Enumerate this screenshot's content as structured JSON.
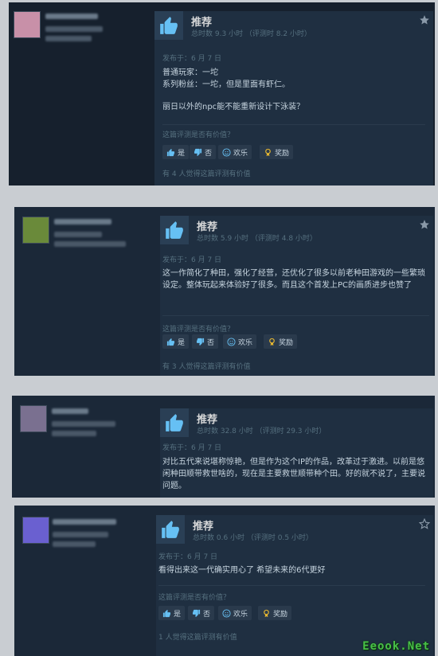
{
  "reviews": [
    {
      "recommend": "推荐",
      "hours": "总时数 9.3 小时  （评测时 8.2 小时）",
      "posted": "发布于：6 月 7 日",
      "text": [
        "普通玩家：一坨",
        "系列粉丝：一坨，但是里面有虾仁。",
        "",
        "丽日以外的npc能不能重新设计下泳装？"
      ],
      "helpful_q": "这篇评测是否有价值？",
      "yes": "是",
      "no": "否",
      "funny": "欢乐",
      "award": "奖励",
      "found": "有 4 人觉得这篇评测有价值",
      "avatar_color": "#c890a8"
    },
    {
      "recommend": "推荐",
      "hours": "总时数 5.9 小时  （评测时 4.8 小时）",
      "posted": "发布于：6 月 7 日",
      "text": [
        "这一作简化了种田，强化了经营，还优化了很多以前老种田游戏的一些繁琐设定。整体玩起来体验好了很多。而且这个首发上PC的画质进步也赞了"
      ],
      "helpful_q": "这篇评测是否有价值？",
      "yes": "是",
      "no": "否",
      "funny": "欢乐",
      "award": "奖励",
      "found": "有 3 人觉得这篇评测有价值",
      "avatar_color": "#6a8a3a"
    },
    {
      "recommend": "推荐",
      "hours": "总时数 32.8 小时  （评测时 29.3 小时）",
      "posted": "发布于：6 月 7 日",
      "text": [
        "对比五代来说堪称惊艳，但是作为这个IP的作品，改革过于激进。以前是悠闲种田顺带救世啥的，现在是主要救世顺带种个田。好的就不说了，主要说问题。"
      ],
      "avatar_color": "#7a7090"
    },
    {
      "recommend": "推荐",
      "hours": "总时数 0.6 小时  （评测时 0.5 小时）",
      "posted": "发布于：6 月 7 日",
      "text": [
        "看得出来这一代确实用心了 希望未来的6代更好"
      ],
      "helpful_q": "这篇评测是否有价值？",
      "yes": "是",
      "no": "否",
      "funny": "欢乐",
      "award": "奖励",
      "found": "1 人觉得这篇评测有价值",
      "avatar_color": "#6a60d0"
    }
  ],
  "watermark": "Eeook.Net",
  "colors": {
    "accent_blue": "#66c0f4",
    "award_gold": "#e8b830",
    "panel_bg": "#1b2838"
  }
}
